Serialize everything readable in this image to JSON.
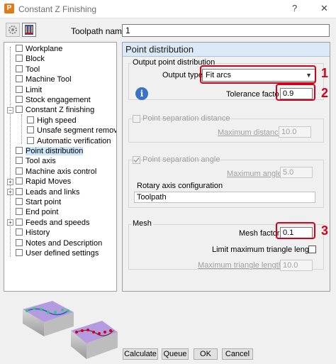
{
  "window": {
    "title": "Constant Z Finishing",
    "help_glyph": "?",
    "close_glyph": "✕",
    "app_icon_letter": "P"
  },
  "toolpath": {
    "label": "Toolpath name",
    "value": "1"
  },
  "tree": {
    "items": [
      {
        "label": "Workplane",
        "icon": "workplane-icon"
      },
      {
        "label": "Block",
        "icon": "block-icon"
      },
      {
        "label": "Tool",
        "icon": "tool-icon"
      },
      {
        "label": "Machine Tool",
        "icon": "machine-tool-icon"
      },
      {
        "label": "Limit",
        "icon": "limit-icon"
      },
      {
        "label": "Stock engagement",
        "icon": "stock-engagement-icon"
      },
      {
        "label": "Constant Z finishing",
        "icon": "constant-z-icon"
      },
      {
        "label": "High speed",
        "icon": "high-speed-icon"
      },
      {
        "label": "Unsafe segment removal",
        "icon": "unsafe-segment-icon"
      },
      {
        "label": "Automatic verification",
        "icon": "verification-icon"
      },
      {
        "label": "Point distribution",
        "icon": "point-distribution-icon"
      },
      {
        "label": "Tool axis",
        "icon": "tool-axis-icon"
      },
      {
        "label": "Machine axis control",
        "icon": "machine-axis-icon"
      },
      {
        "label": "Rapid Moves",
        "icon": "rapid-moves-icon"
      },
      {
        "label": "Leads and links",
        "icon": "leads-links-icon"
      },
      {
        "label": "Start point",
        "icon": "start-point-icon"
      },
      {
        "label": "End point",
        "icon": "end-point-icon"
      },
      {
        "label": "Feeds and speeds",
        "icon": "feeds-speeds-icon"
      },
      {
        "label": "History",
        "icon": "history-icon"
      },
      {
        "label": "Notes and Description",
        "icon": "notes-icon"
      },
      {
        "label": "User defined settings",
        "icon": "user-settings-icon"
      }
    ],
    "expander_collapsed": "+",
    "expander_expanded": "−",
    "selected": "Point distribution"
  },
  "panel": {
    "header": "Point distribution",
    "output": {
      "group_title": "Output point distribution",
      "type_label": "Output type",
      "type_value": "Fit arcs",
      "tolerance_label": "Tolerance facto",
      "tolerance_value": "0.9",
      "info_glyph": "i"
    },
    "separation_distance": {
      "label": "Point separation distance",
      "checked": false,
      "max_label": "Maximum distance",
      "max_value": "10.0"
    },
    "separation_angle": {
      "label": "Point separation angle",
      "checked": true,
      "max_label": "Maximum angle",
      "max_value": "5.0",
      "rotary_label": "Rotary axis configuration",
      "rotary_value": "Toolpath"
    },
    "mesh": {
      "group_title": "Mesh",
      "factor_label": "Mesh factor",
      "factor_value": "0.1",
      "limit_label": "Limit maximum triangle length",
      "limit_checked": false,
      "max_tri_label": "Maximum triangle length",
      "max_tri_value": "10.0"
    }
  },
  "annotations": [
    "1",
    "2",
    "3"
  ],
  "buttons": {
    "calculate": "Calculate",
    "queue": "Queue",
    "ok": "OK",
    "cancel": "Cancel"
  },
  "colors": {
    "annotation": "#d0021b",
    "panel_header": "#dbe9f7",
    "preview_top": "#b49be0",
    "preview_path_green": "#2ecc71",
    "preview_path_red": "#d0021b"
  }
}
